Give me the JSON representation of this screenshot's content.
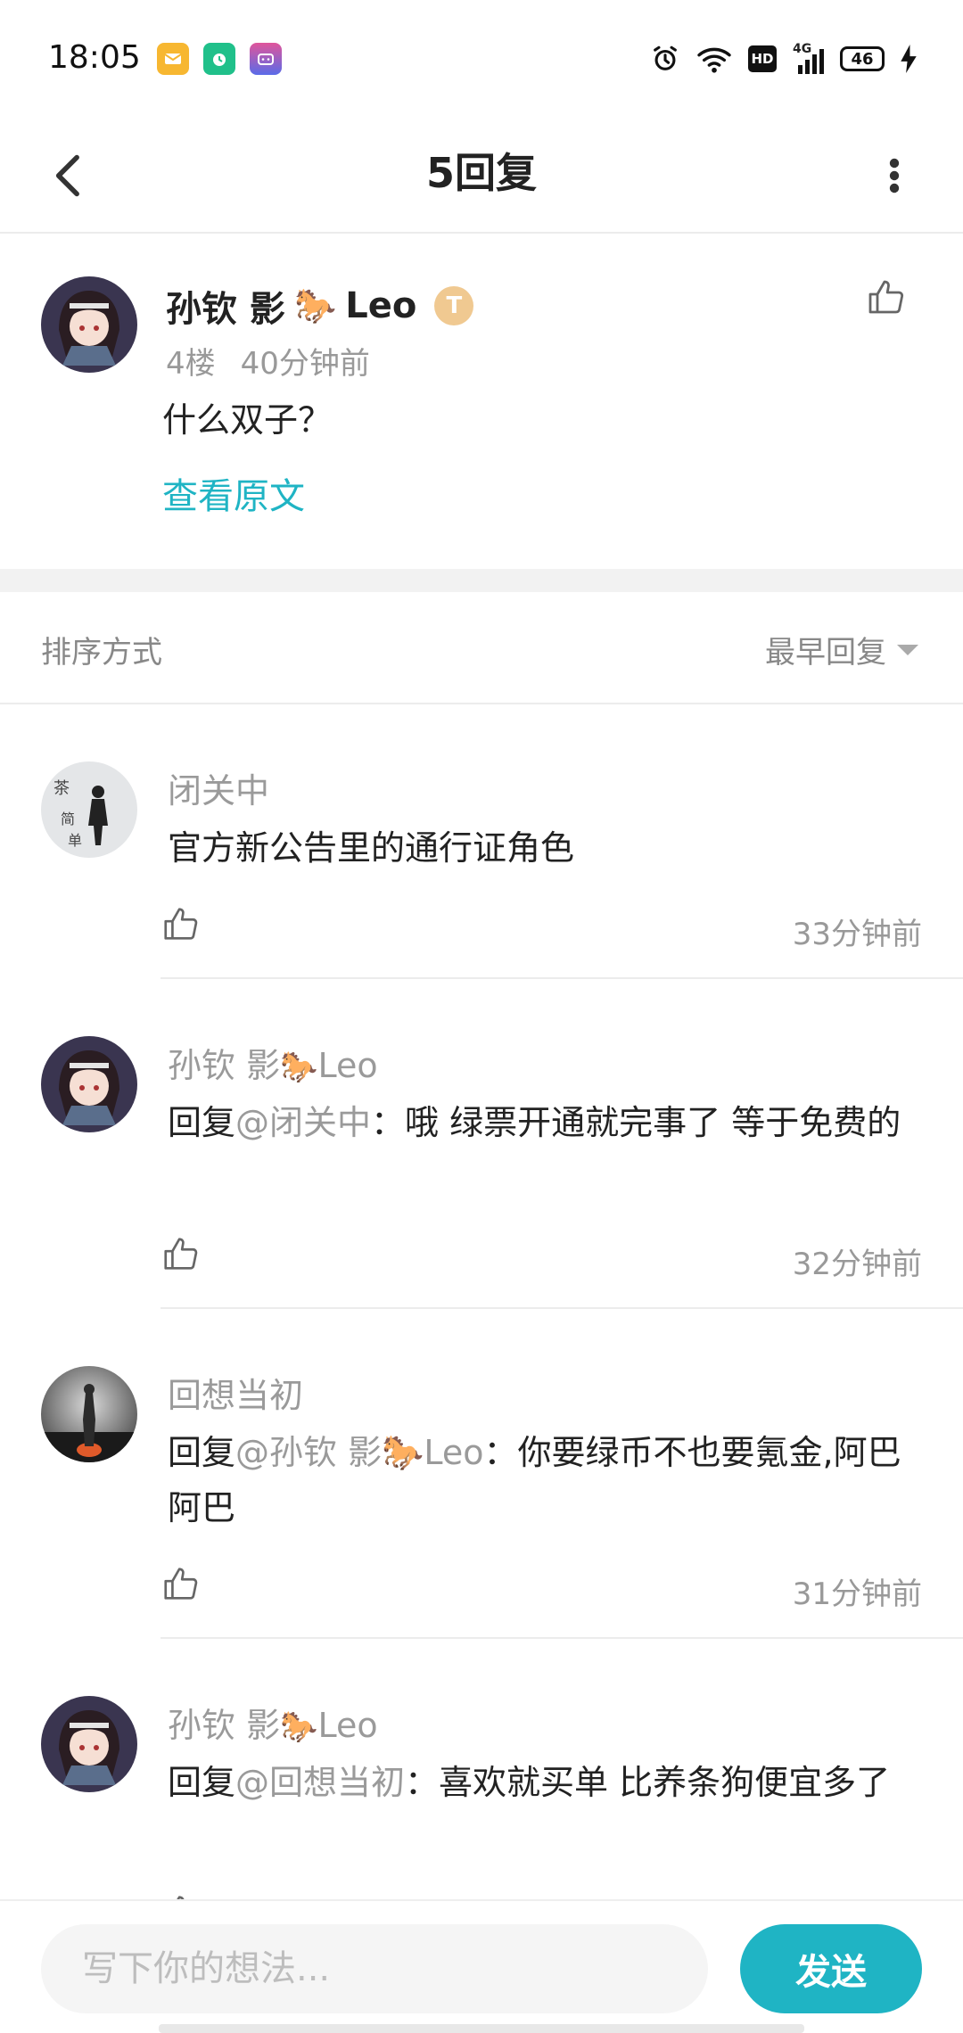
{
  "status_bar": {
    "time": "18:05",
    "battery": "46",
    "network": "4G",
    "hd_label": "HD"
  },
  "header": {
    "title": "5回复"
  },
  "post": {
    "author": "孙钦 影",
    "author_suffix": "Leo",
    "level": "T",
    "floor": "4楼",
    "time": "40分钟前",
    "content": "什么双子？",
    "view_original": "查看原文"
  },
  "sort": {
    "label": "排序方式",
    "selected": "最早回复"
  },
  "replies": [
    {
      "author": "闭关中",
      "author_suffix": "",
      "prefix": "",
      "mention": "",
      "content": "官方新公告里的通行证角色",
      "time": "33分钟前"
    },
    {
      "author": "孙钦 影",
      "author_suffix": "Leo",
      "prefix": "回复",
      "mention": "@闭关中",
      "content": "：哦 绿票开通就完事了 等于免费的",
      "time": "32分钟前"
    },
    {
      "author": "回想当初",
      "author_suffix": "",
      "prefix": "回复",
      "mention": "@孙钦 影🐎Leo",
      "content": "：你要绿币不也要氪金,阿巴阿巴",
      "time": "31分钟前"
    },
    {
      "author": "孙钦 影",
      "author_suffix": "Leo",
      "prefix": "回复",
      "mention": "@回想当初",
      "content": "：喜欢就买单 比养条狗便宜多了",
      "time": ""
    }
  ],
  "composer": {
    "placeholder": "写下你的想法...",
    "send_label": "发送"
  },
  "colors": {
    "accent": "#1fb4c4",
    "secondary_text": "#9a9a9a"
  }
}
